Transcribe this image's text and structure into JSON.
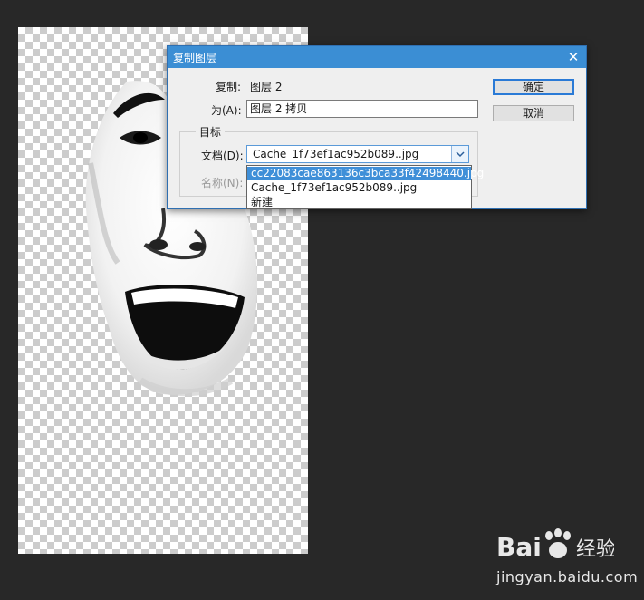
{
  "dialog": {
    "title": "复制图层",
    "copy_label": "复制:",
    "copy_value": "图层 2",
    "as_label": "为(A):",
    "as_value": "图层 2 拷贝",
    "ok_button": "确定",
    "cancel_button": "取消"
  },
  "destination": {
    "group_label": "目标",
    "document_label": "文档(D):",
    "document_value": "Cache_1f73ef1ac952b089..jpg",
    "name_label": "名称(N):",
    "options": [
      "cc22083cae863136c3bca33f42498440.jpg",
      "Cache_1f73ef1ac952b089..jpg",
      "新建"
    ],
    "highlighted_option": "cc22083cae863136c3bca33f42498440.jpg"
  },
  "watermark": {
    "text": "jingyan.baidu.com",
    "brand": "Baidu 经验"
  },
  "colors": {
    "workspace_bg": "#282828",
    "titlebar": "#3b8ed4",
    "selection": "#3f8fd8"
  },
  "icons": [
    "close-icon",
    "chevron-down-icon",
    "baidu-paw-icon"
  ]
}
